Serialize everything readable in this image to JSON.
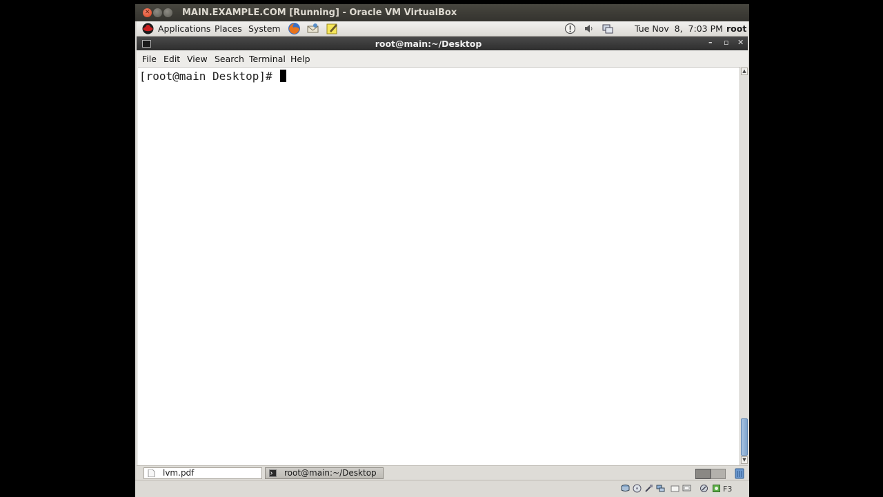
{
  "vbox": {
    "title": "MAIN.EXAMPLE.COM [Running] - Oracle VM VirtualBox",
    "host_key": "F3"
  },
  "panel": {
    "menus": [
      "Applications",
      "Places",
      "System"
    ],
    "clock": "Tue Nov  8,  7:03 PM",
    "user": "root"
  },
  "terminal": {
    "title": "root@main:~/Desktop",
    "menu": [
      "File",
      "Edit",
      "View",
      "Search",
      "Terminal",
      "Help"
    ],
    "prompt": "[root@main Desktop]# "
  },
  "taskbar": {
    "tasks": [
      "lvm.pdf",
      "root@main:~/Desktop"
    ]
  },
  "colors": {
    "titlebar": "#3c3b37",
    "close_button": "#e35b3a",
    "scroll_thumb": "#7ea4cd"
  },
  "icons": {
    "vbox_controls": [
      "close-icon",
      "minimize-icon",
      "maximize-icon"
    ],
    "launchers": [
      "firefox-icon",
      "mail-icon",
      "notes-icon"
    ],
    "tray": [
      "update-icon",
      "volume-icon",
      "network-icon"
    ]
  }
}
